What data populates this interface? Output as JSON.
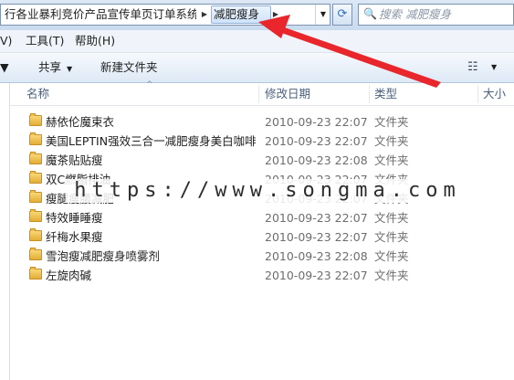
{
  "address": {
    "crumb_parent": "行各业暴利竞价产品宣传单页订单系统...",
    "crumb_current": "减肥瘦身",
    "sep_glyph": "▶",
    "dropdown_glyph": "▼",
    "refresh_glyph": "⟳"
  },
  "search": {
    "placeholder": "搜索 减肥瘦身",
    "icon_glyph": "🔍"
  },
  "menu": {
    "view": "V)",
    "tools": "工具(T)",
    "help": "帮助(H)"
  },
  "commands": {
    "share": "共享",
    "new_folder": "新建文件夹",
    "dropdown_glyph": "▼",
    "views_glyph": "☷"
  },
  "columns": {
    "name": "名称",
    "date": "修改日期",
    "type": "类型",
    "size": "大小",
    "sort_glyph": "^"
  },
  "files": [
    {
      "name": "赫依伦魔束衣",
      "date": "2010-09-23 22:07",
      "type": "文件夹"
    },
    {
      "name": "美国LEPTIN强效三合一减肥瘦身美白咖啡",
      "date": "2010-09-23 22:07",
      "type": "文件夹"
    },
    {
      "name": "魔茶贴贴瘦",
      "date": "2010-09-23 22:08",
      "type": "文件夹"
    },
    {
      "name": "双C燃脂排油",
      "date": "2010-09-23 22:07",
      "type": "文件夹"
    },
    {
      "name": "瘦腿瘦腰减肥",
      "date": "2010-09-23 22:07",
      "type": "文件夹"
    },
    {
      "name": "特效睡睡瘦",
      "date": "2010-09-23 22:07",
      "type": "文件夹"
    },
    {
      "name": "纤梅水果瘦",
      "date": "2010-09-23 22:07",
      "type": "文件夹"
    },
    {
      "name": "雪泡瘦减肥瘦身喷雾剂",
      "date": "2010-09-23 22:08",
      "type": "文件夹"
    },
    {
      "name": "左旋肉碱",
      "date": "2010-09-23 22:07",
      "type": "文件夹"
    }
  ],
  "watermark": "https://www.songma.com",
  "colors": {
    "annotation_arrow": "#e8262b",
    "folder": "#f0c24f"
  }
}
